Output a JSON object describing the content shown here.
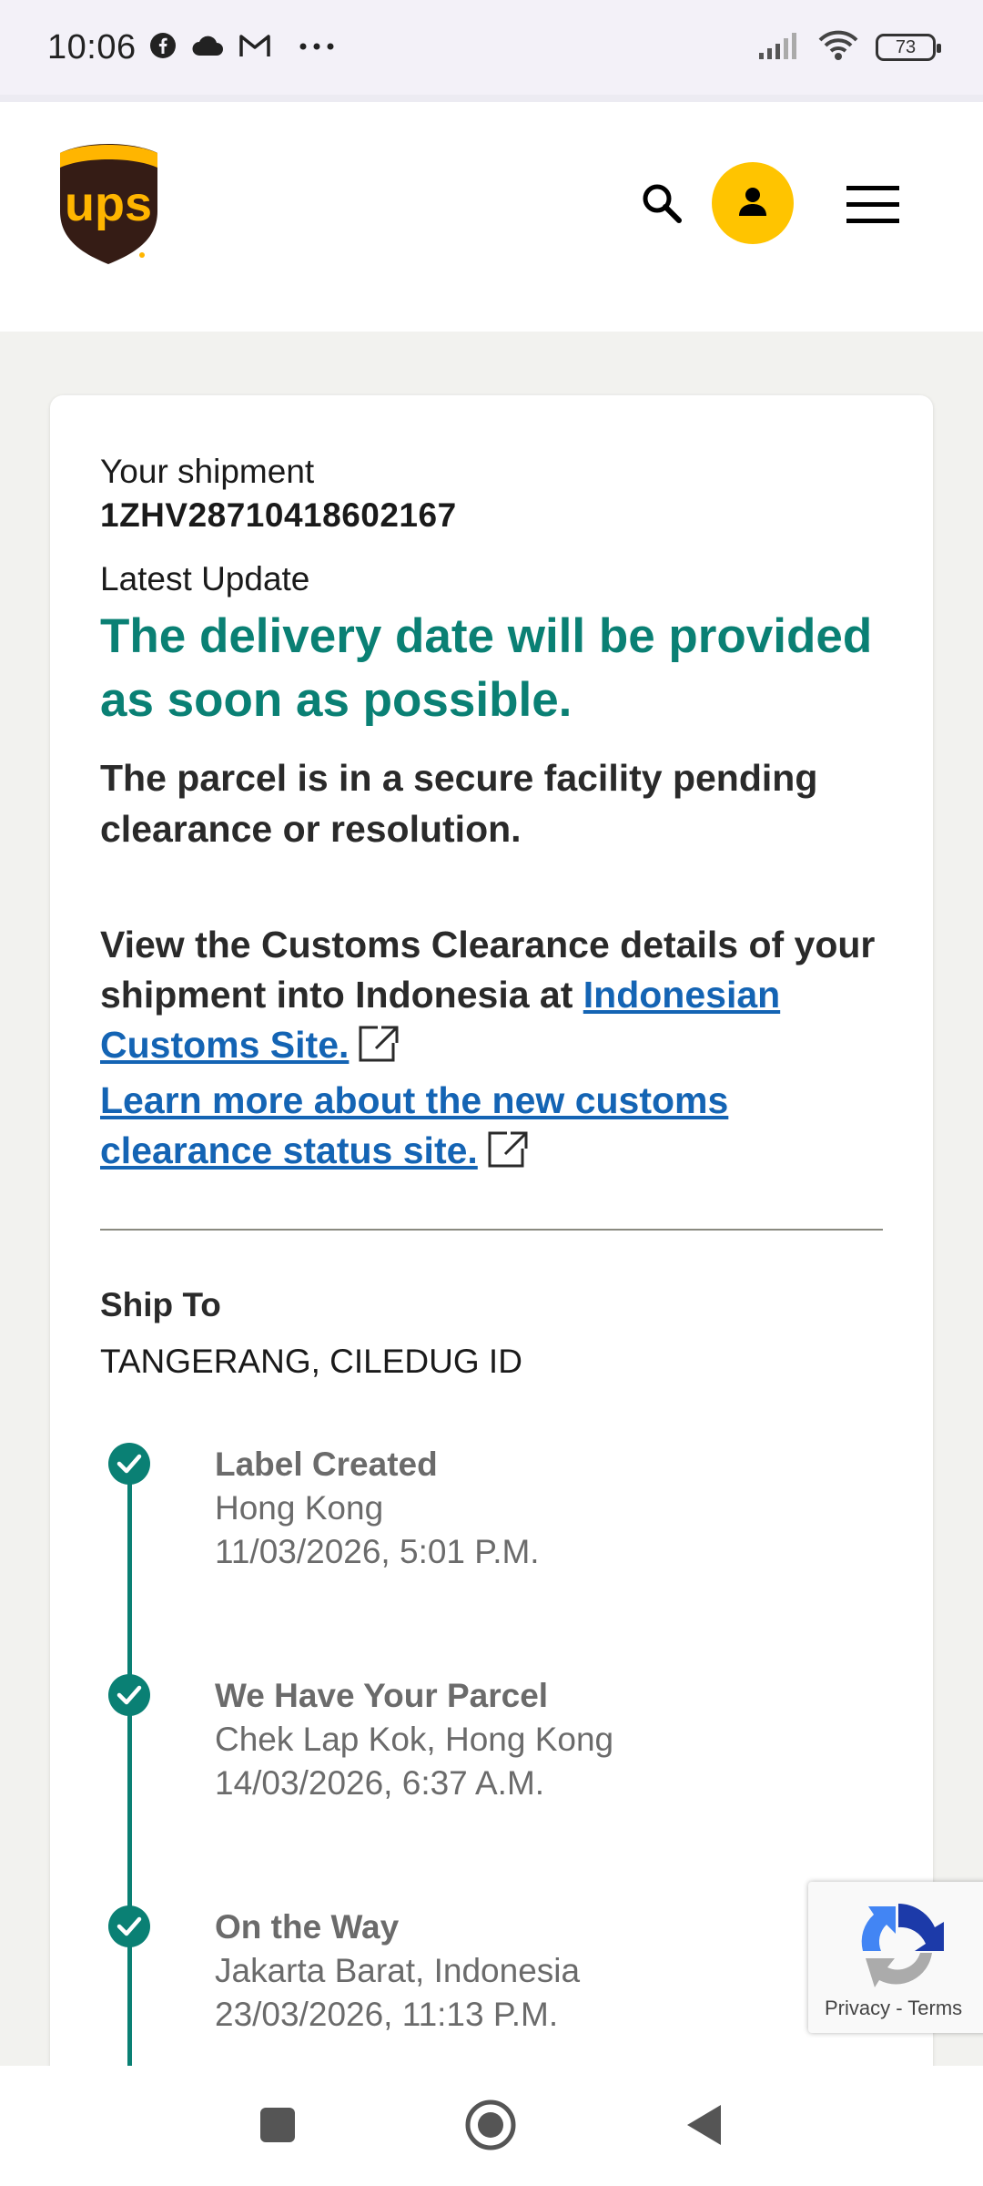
{
  "status_bar": {
    "time": "10:06",
    "battery": "73"
  },
  "header": {
    "logo_text": "ups"
  },
  "shipment": {
    "label": "Your shipment",
    "tracking_number": "1ZHV28710418602167",
    "latest_update_label": "Latest Update",
    "headline": "The delivery date will be provided as soon as possible.",
    "status_description": "The parcel is in a secure facility pending clearance or resolution.",
    "customs_text": "View the Customs Clearance details of your shipment into Indonesia at ",
    "customs_link": "Indonesian Customs Site.",
    "learn_more_link": "Learn more about the new customs clearance status site."
  },
  "ship_to": {
    "label": "Ship To",
    "value": "TANGERANG, CILEDUG ID"
  },
  "timeline": [
    {
      "title": "Label Created",
      "location": "Hong Kong",
      "datetime": "11/03/2026, 5:01 P.M."
    },
    {
      "title": "We Have Your Parcel",
      "location": "Chek Lap Kok, Hong Kong",
      "datetime": "14/03/2026, 6:37 A.M."
    },
    {
      "title": "On the Way",
      "location": "Jakarta Barat, Indonesia",
      "datetime": "23/03/2026, 11:13 P.M."
    }
  ],
  "recaptcha": {
    "text": "Privacy - Terms"
  },
  "colors": {
    "accent_teal": "#0a8074",
    "link_blue": "#1464b4",
    "ups_brown": "#351c15",
    "ups_gold": "#ffb500",
    "account_yellow": "#ffc400"
  },
  "icons": [
    "facebook-icon",
    "cloud-icon",
    "gmail-icon",
    "more-icon",
    "signal-icon",
    "wifi-icon",
    "battery-icon",
    "search-icon",
    "account-icon",
    "menu-icon",
    "external-link-icon",
    "check-icon",
    "recaptcha-icon",
    "recent-apps-icon",
    "home-icon",
    "back-icon"
  ]
}
